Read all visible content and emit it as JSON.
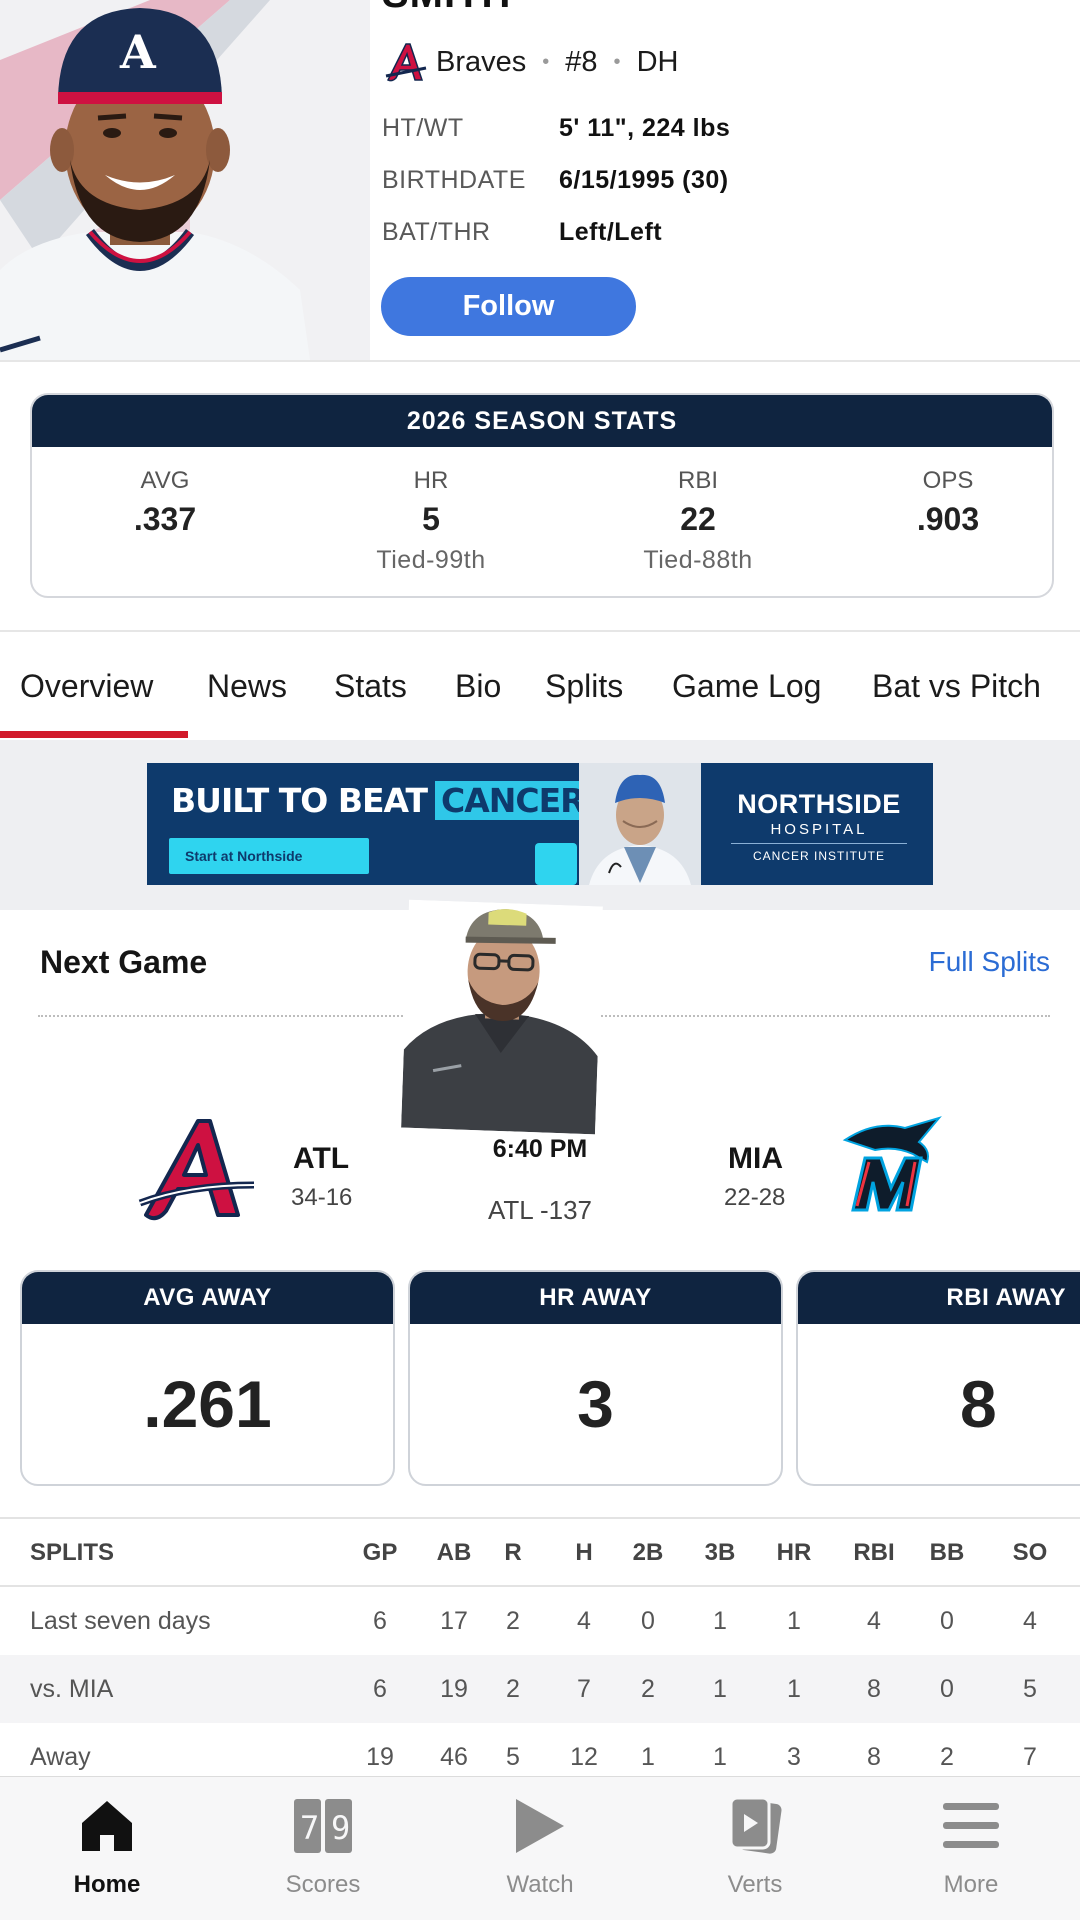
{
  "player": {
    "name": "SMITH",
    "team": "Braves",
    "number": "#8",
    "position": "DH",
    "bio": [
      {
        "label": "HT/WT",
        "value": "5' 11\", 224 lbs"
      },
      {
        "label": "BIRTHDATE",
        "value": "6/15/1995 (30)"
      },
      {
        "label": "BAT/THR",
        "value": "Left/Left"
      }
    ],
    "follow_label": "Follow"
  },
  "season_stats": {
    "title": "2026 SEASON STATS",
    "stats": [
      {
        "label": "AVG",
        "value": ".337",
        "rank": ""
      },
      {
        "label": "HR",
        "value": "5",
        "rank": "Tied-99th"
      },
      {
        "label": "RBI",
        "value": "22",
        "rank": "Tied-88th"
      },
      {
        "label": "OPS",
        "value": ".903",
        "rank": ""
      }
    ]
  },
  "tabs": [
    "Overview",
    "News",
    "Stats",
    "Bio",
    "Splits",
    "Game Log",
    "Bat vs Pitch"
  ],
  "active_tab": "Overview",
  "ad": {
    "headline": "BUILT TO BEAT",
    "headline_highlight": "CANCER",
    "cta": "Start at Northside",
    "brand_line1": "NORTHSIDE",
    "brand_line2": "HOSPITAL",
    "brand_line3": "CANCER INSTITUTE"
  },
  "next_game": {
    "title": "Next Game",
    "link": "Full Splits",
    "home": {
      "abbr": "ATL",
      "record": "34-16"
    },
    "away": {
      "abbr": "MIA",
      "record": "22-28"
    },
    "time": "6:40 PM",
    "odds": "ATL -137",
    "tiles": [
      {
        "label": "AVG AWAY",
        "value": ".261"
      },
      {
        "label": "HR AWAY",
        "value": "3"
      },
      {
        "label": "RBI AWAY",
        "value": "8"
      }
    ]
  },
  "splits": {
    "headers": [
      "SPLITS",
      "GP",
      "AB",
      "R",
      "H",
      "2B",
      "3B",
      "HR",
      "RBI",
      "BB",
      "SO"
    ],
    "rows": [
      [
        "Last seven days",
        "6",
        "17",
        "2",
        "4",
        "0",
        "1",
        "1",
        "4",
        "0",
        "4"
      ],
      [
        "vs. MIA",
        "6",
        "19",
        "2",
        "7",
        "2",
        "1",
        "1",
        "8",
        "0",
        "5"
      ],
      [
        "Away",
        "19",
        "46",
        "5",
        "12",
        "1",
        "1",
        "3",
        "8",
        "2",
        "7"
      ]
    ]
  },
  "bottom_nav": [
    {
      "label": "Home",
      "icon": "home-icon",
      "active": true
    },
    {
      "label": "Scores",
      "icon": "scoreboard-icon",
      "active": false
    },
    {
      "label": "Watch",
      "icon": "play-icon",
      "active": false
    },
    {
      "label": "Verts",
      "icon": "vertical-video-icon",
      "active": false
    },
    {
      "label": "More",
      "icon": "menu-icon",
      "active": false
    }
  ],
  "colors": {
    "navy": "#0f2440",
    "follow_blue": "#3f77df",
    "link_blue": "#2b6cd4",
    "tab_underline": "#d1192a",
    "braves_red": "#ce1141",
    "marlins_teal": "#00a3e0"
  }
}
